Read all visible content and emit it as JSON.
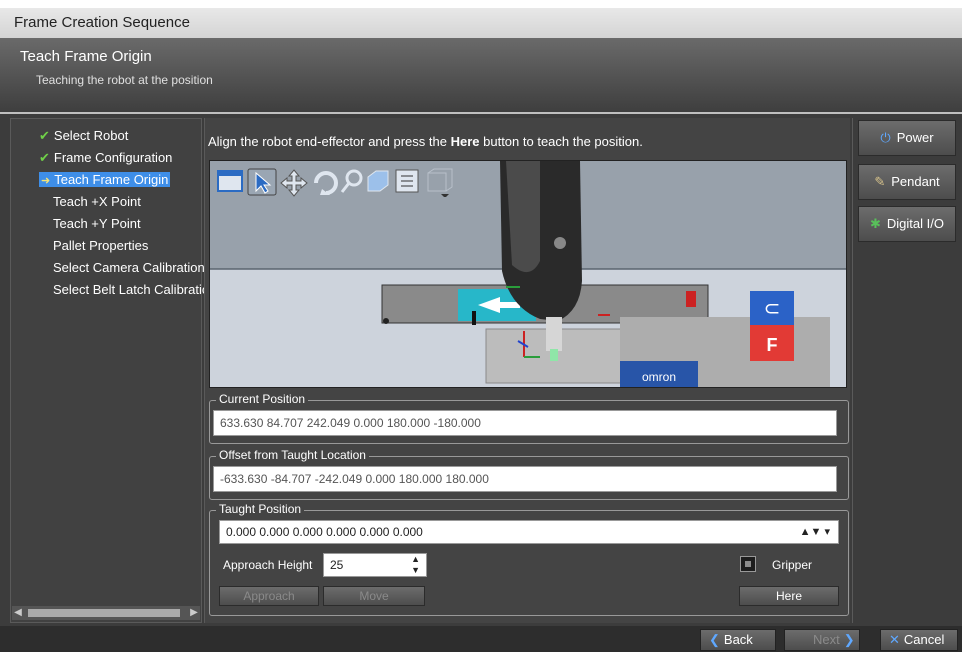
{
  "window": {
    "title": "Frame Creation Sequence"
  },
  "header": {
    "title": "Teach Frame Origin",
    "subtitle": "Teaching the robot at the position"
  },
  "steps": [
    {
      "label": "Select Robot",
      "state": "done"
    },
    {
      "label": "Frame Configuration",
      "state": "done"
    },
    {
      "label": "Teach Frame Origin",
      "state": "active"
    },
    {
      "label": "Teach +X Point",
      "state": "pending"
    },
    {
      "label": "Teach +Y Point",
      "state": "pending"
    },
    {
      "label": "Pallet Properties",
      "state": "pending"
    },
    {
      "label": "Select Camera Calibration",
      "state": "pending"
    },
    {
      "label": "Select Belt Latch Calibration",
      "state": "pending"
    }
  ],
  "instruction": {
    "before": "Align the robot end-effector and press the ",
    "bold": "Here",
    "after": " button to teach the position."
  },
  "viewport": {
    "brand_label": "omron",
    "c_label": "⊂",
    "f_label": "F"
  },
  "current_position": {
    "label": "Current Position",
    "value": "633.630 84.707 242.049 0.000 180.000 -180.000"
  },
  "offset": {
    "label": "Offset from Taught Location",
    "value": "-633.630 -84.707 -242.049 0.000 180.000 180.000"
  },
  "taught": {
    "label": "Taught Position",
    "value": "0.000 0.000 0.000 0.000 0.000 0.000",
    "approach_label": "Approach Height",
    "approach_value": "25",
    "gripper_label": "Gripper",
    "approach_button": "Approach",
    "move_button": "Move",
    "here_button": "Here"
  },
  "right_buttons": {
    "power": "Power",
    "pendant": "Pendant",
    "digital_io": "Digital I/O"
  },
  "footer": {
    "back": "Back",
    "next": "Next",
    "cancel": "Cancel"
  }
}
